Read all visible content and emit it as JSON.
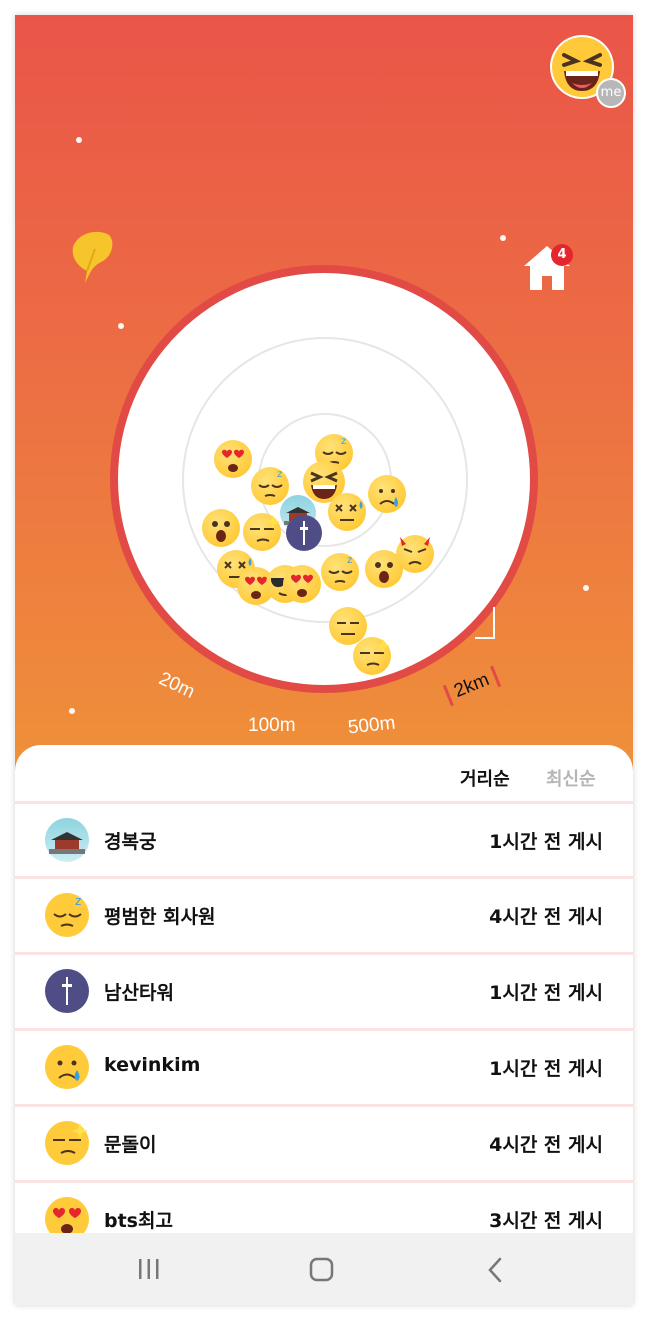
{
  "header": {
    "me_badge": "me",
    "home_badge_count": "4"
  },
  "radar": {
    "scale_labels": [
      "20m",
      "100m",
      "500m",
      "2km"
    ],
    "pins": [
      {
        "icon": "heart-eyes-emoji"
      },
      {
        "icon": "sleepy-emoji"
      },
      {
        "icon": "sleepy-emoji"
      },
      {
        "icon": "laughing-emoji"
      },
      {
        "icon": "dizzy-sweat-emoji"
      },
      {
        "icon": "sad-tear-emoji"
      },
      {
        "icon": "surprised-emoji"
      },
      {
        "icon": "smug-sparkle-emoji"
      },
      {
        "icon": "palace-icon"
      },
      {
        "icon": "namsan-tower-icon"
      },
      {
        "icon": "dizzy-sweat-emoji"
      },
      {
        "icon": "heart-eyes-emoji"
      },
      {
        "icon": "sunglasses-emoji"
      },
      {
        "icon": "heart-eyes-emoji"
      },
      {
        "icon": "sleepy-emoji"
      },
      {
        "icon": "surprised-emoji"
      },
      {
        "icon": "devil-emoji"
      },
      {
        "icon": "expressionless-emoji"
      },
      {
        "icon": "smug-sparkle-emoji"
      }
    ]
  },
  "sort_tabs": {
    "distance": "거리순",
    "latest": "최신순",
    "active": "distance"
  },
  "list": [
    {
      "name": "경복궁",
      "time": "1시간 전 게시",
      "icon": "palace-icon"
    },
    {
      "name": "평범한 회사원",
      "time": "4시간 전 게시",
      "icon": "sleepy-emoji"
    },
    {
      "name": "남산타워",
      "time": "1시간 전 게시",
      "icon": "namsan-tower-icon"
    },
    {
      "name": "kevinkim",
      "time": "1시간 전 게시",
      "icon": "sad-tear-emoji"
    },
    {
      "name": "문돌이",
      "time": "4시간 전 게시",
      "icon": "smug-sparkle-emoji"
    },
    {
      "name": "bts최고",
      "time": "3시간 전 게시",
      "icon": "heart-eyes-emoji"
    }
  ],
  "colors": {
    "accent_red": "#e14a45",
    "gradient_top": "#ea5548",
    "gradient_bottom": "#ef9139",
    "badge_red": "#e5262c"
  }
}
